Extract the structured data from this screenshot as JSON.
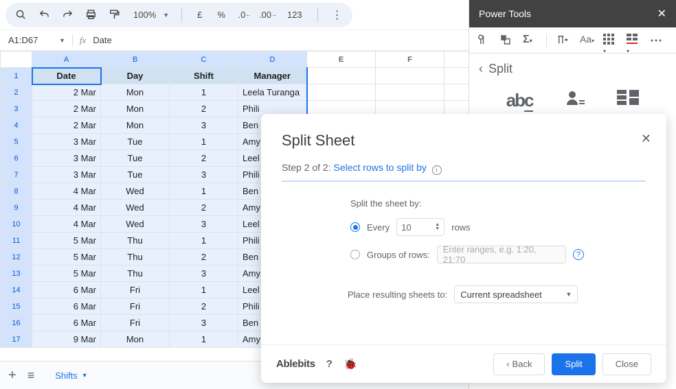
{
  "toolbar": {
    "zoom": "100%",
    "currency": "£",
    "percent": "%",
    "num_format": "123"
  },
  "namebox": {
    "ref": "A1:D67",
    "formula": "Date"
  },
  "columns": [
    "A",
    "B",
    "C",
    "D",
    "E",
    "F"
  ],
  "headers": [
    "Date",
    "Day",
    "Shift",
    "Manager"
  ],
  "rows": [
    {
      "n": 2,
      "date": "2 Mar",
      "day": "Mon",
      "shift": "1",
      "mgr": "Leela Turanga"
    },
    {
      "n": 3,
      "date": "2 Mar",
      "day": "Mon",
      "shift": "2",
      "mgr": "Phili"
    },
    {
      "n": 4,
      "date": "2 Mar",
      "day": "Mon",
      "shift": "3",
      "mgr": "Ben"
    },
    {
      "n": 5,
      "date": "3 Mar",
      "day": "Tue",
      "shift": "1",
      "mgr": "Amy"
    },
    {
      "n": 6,
      "date": "3 Mar",
      "day": "Tue",
      "shift": "2",
      "mgr": "Leel"
    },
    {
      "n": 7,
      "date": "3 Mar",
      "day": "Tue",
      "shift": "3",
      "mgr": "Phili"
    },
    {
      "n": 8,
      "date": "4 Mar",
      "day": "Wed",
      "shift": "1",
      "mgr": "Ben"
    },
    {
      "n": 9,
      "date": "4 Mar",
      "day": "Wed",
      "shift": "2",
      "mgr": "Amy"
    },
    {
      "n": 10,
      "date": "4 Mar",
      "day": "Wed",
      "shift": "3",
      "mgr": "Leel"
    },
    {
      "n": 11,
      "date": "5 Mar",
      "day": "Thu",
      "shift": "1",
      "mgr": "Phili"
    },
    {
      "n": 12,
      "date": "5 Mar",
      "day": "Thu",
      "shift": "2",
      "mgr": "Ben"
    },
    {
      "n": 13,
      "date": "5 Mar",
      "day": "Thu",
      "shift": "3",
      "mgr": "Amy"
    },
    {
      "n": 14,
      "date": "6 Mar",
      "day": "Fri",
      "shift": "1",
      "mgr": "Leel"
    },
    {
      "n": 15,
      "date": "6 Mar",
      "day": "Fri",
      "shift": "2",
      "mgr": "Phili"
    },
    {
      "n": 16,
      "date": "6 Mar",
      "day": "Fri",
      "shift": "3",
      "mgr": "Ben"
    },
    {
      "n": 17,
      "date": "9 Mar",
      "day": "Mon",
      "shift": "1",
      "mgr": "Amy"
    }
  ],
  "sheet_tab": "Shifts",
  "sidepanel": {
    "title": "Power Tools",
    "crumb": "Split"
  },
  "dialog": {
    "title": "Split Sheet",
    "step_prefix": "Step 2 of 2: ",
    "step_link": "Select rows to split by",
    "label_splitby": "Split the sheet by:",
    "opt_every": "Every",
    "every_value": "10",
    "every_suffix": "rows",
    "opt_groups": "Groups of rows:",
    "groups_placeholder": "Enter ranges, e.g. 1:20, 21:70",
    "label_place": "Place resulting sheets to:",
    "place_value": "Current spreadsheet",
    "brand": "Ablebits",
    "btn_back": "Back",
    "btn_split": "Split",
    "btn_close": "Close"
  }
}
